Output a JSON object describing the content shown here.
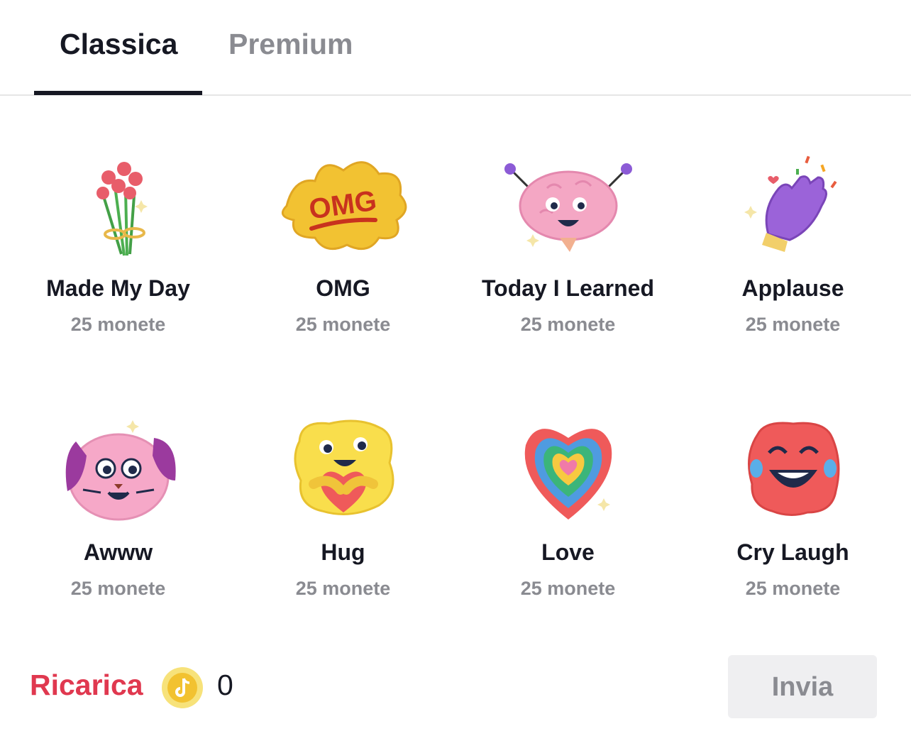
{
  "tabs": [
    {
      "label": "Classica",
      "active": true
    },
    {
      "label": "Premium",
      "active": false
    }
  ],
  "gifts": [
    {
      "name": "Made My Day",
      "price": "25 monete",
      "icon": "rose-bouquet-icon"
    },
    {
      "name": "OMG",
      "price": "25 monete",
      "icon": "omg-splash-icon"
    },
    {
      "name": "Today I Learned",
      "price": "25 monete",
      "icon": "brain-icon"
    },
    {
      "name": "Applause",
      "price": "25 monete",
      "icon": "clapping-hands-icon"
    },
    {
      "name": "Awww",
      "price": "25 monete",
      "icon": "puppy-face-icon"
    },
    {
      "name": "Hug",
      "price": "25 monete",
      "icon": "hug-heart-icon"
    },
    {
      "name": "Love",
      "price": "25 monete",
      "icon": "rainbow-heart-icon"
    },
    {
      "name": "Cry Laugh",
      "price": "25 monete",
      "icon": "cry-laugh-face-icon"
    }
  ],
  "footer": {
    "recharge_label": "Ricarica",
    "coin_icon": "tiktok-coin-icon",
    "balance": "0",
    "send_label": "Invia"
  },
  "colors": {
    "accent": "#e0384f",
    "text_primary": "#161823",
    "text_secondary": "#8a8b91",
    "button_disabled_bg": "#efeff1"
  }
}
